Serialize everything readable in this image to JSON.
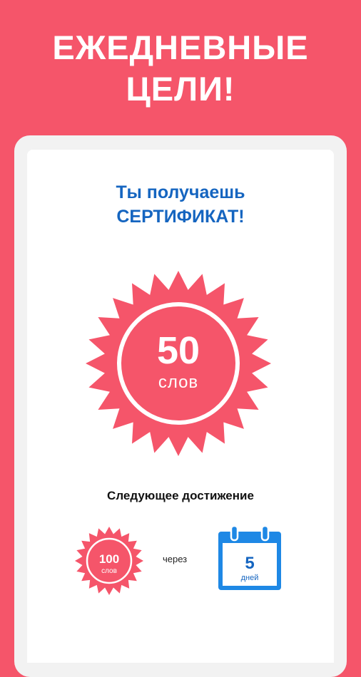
{
  "header": {
    "line1": "ЕЖЕДНЕВНЫЕ",
    "line2": "ЦЕЛИ!"
  },
  "certificate": {
    "line1": "Ты получаешь",
    "line2": "СЕРТИФИКАТ!"
  },
  "badge": {
    "value": "50",
    "unit": "слов"
  },
  "next": {
    "label": "Следующее достижение",
    "badge_value": "100",
    "badge_unit": "слов",
    "through": "через",
    "days_value": "5",
    "days_unit": "дней"
  },
  "colors": {
    "accent": "#f5556a",
    "blue": "#1565c0",
    "calendar_blue": "#1e88e5"
  },
  "icons": [
    "starburst-badge-icon",
    "calendar-icon"
  ]
}
